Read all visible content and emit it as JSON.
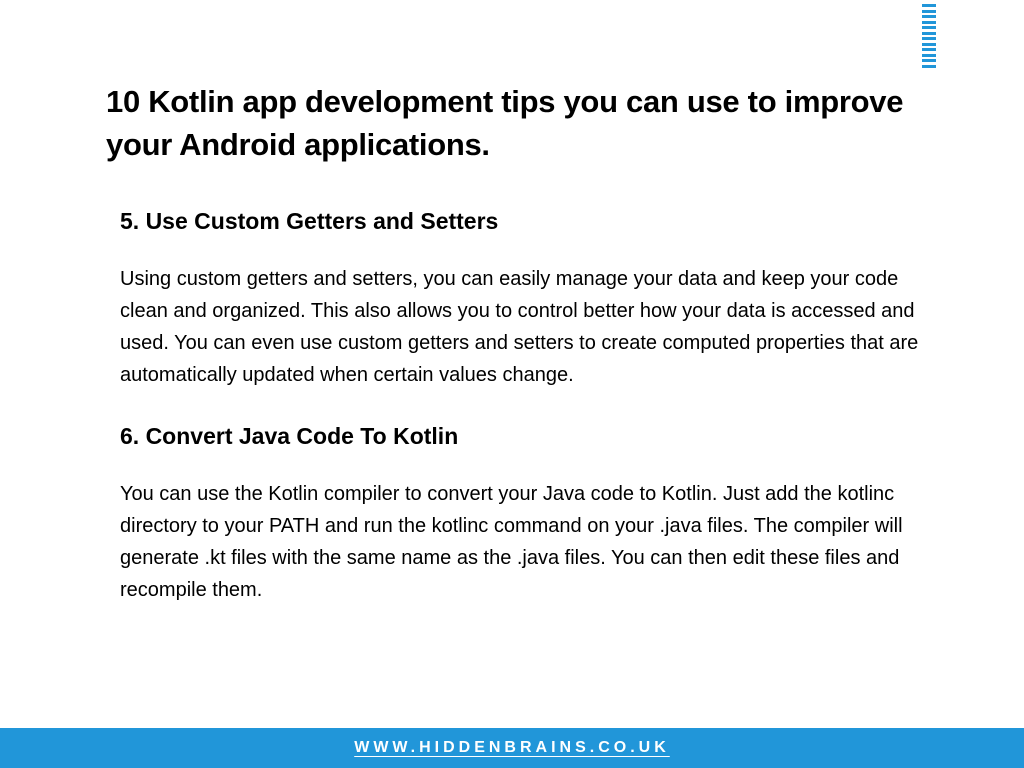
{
  "main_title": "10 Kotlin app development tips you can use to improve your Android applications.",
  "sections": [
    {
      "heading": "5. Use Custom Getters and Setters",
      "body": "Using custom getters and setters, you can easily manage your data and keep your code clean and organized. This also allows you to control better how your data is accessed and used. You can even use custom getters and setters to create computed properties that are automatically updated when certain values change."
    },
    {
      "heading": "6. Convert Java Code To Kotlin",
      "body": "You can use the Kotlin compiler to convert your Java code to Kotlin. Just add the kotlinc directory to your PATH and run the kotlinc command on your .java files. The compiler will generate .kt files with the same name as the .java files. You can then edit these files and recompile them."
    }
  ],
  "footer_url": "WWW.HIDDENBRAINS.CO.UK"
}
